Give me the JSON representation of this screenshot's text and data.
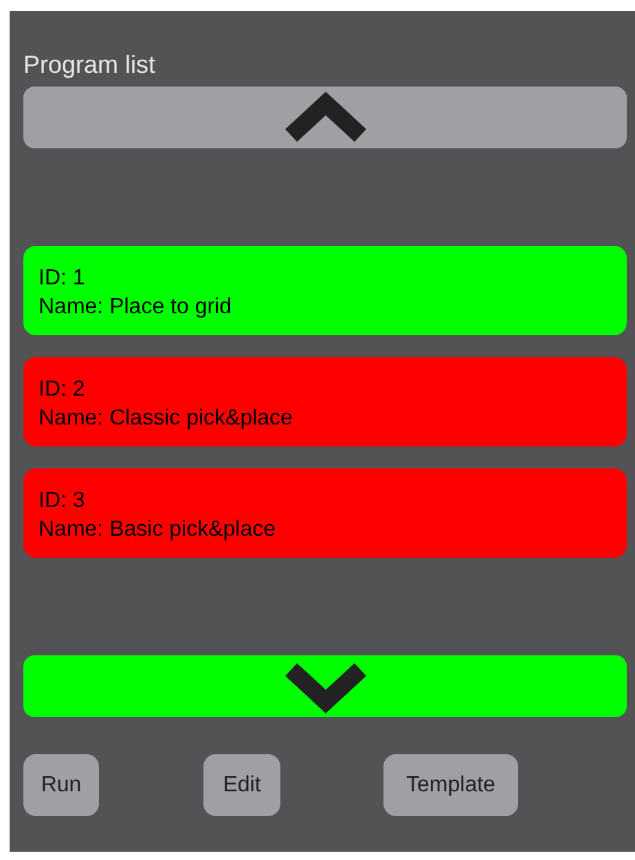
{
  "title": "Program list",
  "scroll_up": {
    "enabled": false
  },
  "programs": [
    {
      "id": "ID: 1",
      "name": "Name: Place to grid",
      "color": "#00ff00"
    },
    {
      "id": "ID: 2",
      "name": "Name: Classic pick&place",
      "color": "#ff0000"
    },
    {
      "id": "ID: 3",
      "name": "Name: Basic pick&place",
      "color": "#ff0000"
    }
  ],
  "scroll_down": {
    "enabled": true
  },
  "buttons": [
    "Run",
    "Edit",
    "Template"
  ]
}
